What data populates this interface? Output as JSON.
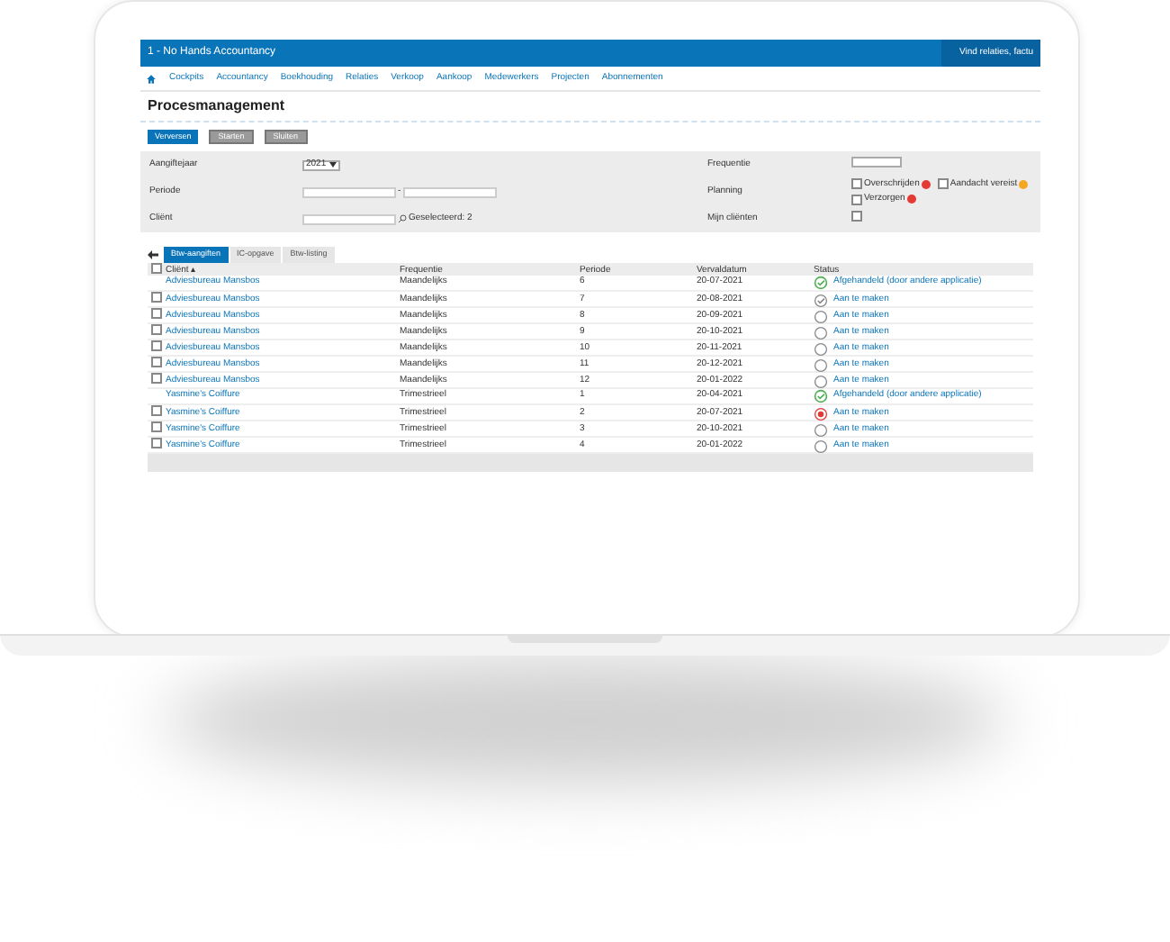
{
  "app": {
    "company": "1 - No Hands Accountancy",
    "search_placeholder": "Vind relaties, factu"
  },
  "nav": [
    "Cockpits",
    "Accountancy",
    "Boekhouding",
    "Relaties",
    "Verkoop",
    "Aankoop",
    "Medewerkers",
    "Projecten",
    "Abonnementen"
  ],
  "page_title": "Procesmanagement",
  "buttons": [
    {
      "label": "Verversen",
      "primary": true
    },
    {
      "label": "Starten",
      "primary": false
    },
    {
      "label": "Sluiten",
      "primary": false
    }
  ],
  "filters": {
    "aangiftejaar_label": "Aangiftejaar",
    "aangiftejaar_value": "2021",
    "periode_label": "Periode",
    "periode_sep": "-",
    "client_label": "Cliënt",
    "client_selected": "Geselecteerd: 2",
    "frequentie_label": "Frequentie",
    "planning_label": "Planning",
    "planning_options": [
      {
        "label": "Overschrijden",
        "checked": false,
        "color": "#e53935"
      },
      {
        "label": "Aandacht vereist",
        "checked": false,
        "color": "#f5a623"
      },
      {
        "label": "Verzorgen",
        "checked": false,
        "color": "#e53935"
      }
    ],
    "mijn_label": "Mijn cliënten",
    "mijn_checked": false
  },
  "tabs": [
    {
      "label": "Btw-aangiften",
      "selected": true
    },
    {
      "label": "IC-opgave",
      "selected": false
    },
    {
      "label": "Btw-listing",
      "selected": false
    }
  ],
  "table": {
    "select_all_checked": false,
    "columns": [
      "Cliënt ▴",
      "Frequentie",
      "Periode",
      "Vervaldatum",
      "Status"
    ],
    "rows": [
      {
        "client": "Adviesbureau Mansbos",
        "freq": "Maandelijks",
        "period": "6",
        "due": "20-07-2021",
        "status": "Afgehandeld (door andere applicatie)",
        "kind": "done",
        "selectable": false
      },
      {
        "client": "Adviesbureau Mansbos",
        "freq": "Maandelijks",
        "period": "7",
        "due": "20-08-2021",
        "status": "Aan te maken",
        "kind": "partial",
        "selectable": true,
        "checked": false
      },
      {
        "client": "Adviesbureau Mansbos",
        "freq": "Maandelijks",
        "period": "8",
        "due": "20-09-2021",
        "status": "Aan te maken",
        "kind": "open",
        "selectable": true,
        "checked": false
      },
      {
        "client": "Adviesbureau Mansbos",
        "freq": "Maandelijks",
        "period": "9",
        "due": "20-10-2021",
        "status": "Aan te maken",
        "kind": "open",
        "selectable": true,
        "checked": false
      },
      {
        "client": "Adviesbureau Mansbos",
        "freq": "Maandelijks",
        "period": "10",
        "due": "20-11-2021",
        "status": "Aan te maken",
        "kind": "open",
        "selectable": true,
        "checked": false
      },
      {
        "client": "Adviesbureau Mansbos",
        "freq": "Maandelijks",
        "period": "11",
        "due": "20-12-2021",
        "status": "Aan te maken",
        "kind": "open",
        "selectable": true,
        "checked": false
      },
      {
        "client": "Adviesbureau Mansbos",
        "freq": "Maandelijks",
        "period": "12",
        "due": "20-01-2022",
        "status": "Aan te maken",
        "kind": "open",
        "selectable": true,
        "checked": false
      },
      {
        "client": "Yasmine's Coiffure",
        "freq": "Trimestrieel",
        "period": "1",
        "due": "20-04-2021",
        "status": "Afgehandeld (door andere applicatie)",
        "kind": "done",
        "selectable": false
      },
      {
        "client": "Yasmine's Coiffure",
        "freq": "Trimestrieel",
        "period": "2",
        "due": "20-07-2021",
        "status": "Aan te maken",
        "kind": "overdue",
        "selectable": true,
        "checked": false
      },
      {
        "client": "Yasmine's Coiffure",
        "freq": "Trimestrieel",
        "period": "3",
        "due": "20-10-2021",
        "status": "Aan te maken",
        "kind": "open",
        "selectable": true,
        "checked": false
      },
      {
        "client": "Yasmine's Coiffure",
        "freq": "Trimestrieel",
        "period": "4",
        "due": "20-01-2022",
        "status": "Aan te maken",
        "kind": "open",
        "selectable": true,
        "checked": false
      }
    ]
  }
}
